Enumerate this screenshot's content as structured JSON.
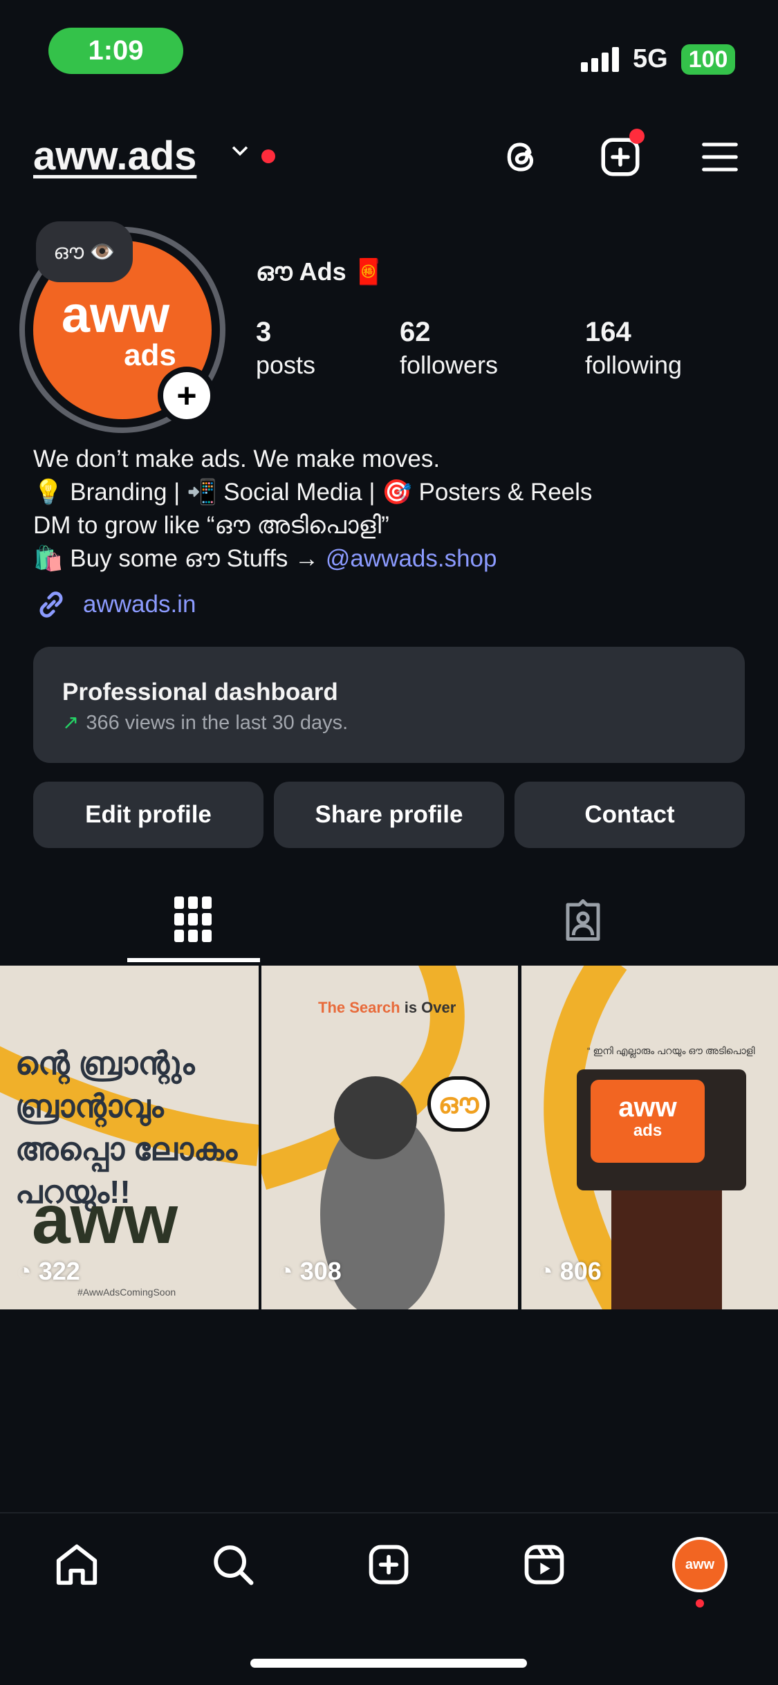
{
  "status_bar": {
    "time": "1:09",
    "network": "5G",
    "battery": "100"
  },
  "header": {
    "username": "aww.ads"
  },
  "profile": {
    "note": "ഔ 👁️",
    "avatar_text": "aww",
    "avatar_sub": "ads",
    "display_name": "ഔ Ads 🧧",
    "stats": [
      {
        "value": "3",
        "label": "posts"
      },
      {
        "value": "62",
        "label": "followers"
      },
      {
        "value": "164",
        "label": "following"
      }
    ],
    "bio": [
      "We don’t make ads. We make moves.",
      "💡 Branding | 📲 Social Media | 🎯 Posters & Reels",
      "DM to grow like “ഔ അടിപൊളി”"
    ],
    "bio_last_prefix": "🛍️ Buy some ഔ Stuffs → ",
    "bio_mention": "@awwads.shop",
    "link": "awwads.in"
  },
  "dashboard": {
    "title": "Professional dashboard",
    "subtitle": "366 views in the last 30 days."
  },
  "buttons": {
    "edit": "Edit profile",
    "share": "Share profile",
    "contact": "Contact"
  },
  "posts": [
    {
      "views": "322",
      "headline": "ന്റെ ബ്രാന്റും ബ്രാന്റാവും അപ്പൊ ലോകം പറയും!!",
      "logo": "aww",
      "tag": "#AwwAdsComingSoon"
    },
    {
      "views": "308",
      "title_a": "The Search",
      "title_b": " is Over",
      "bubble": "ഔ"
    },
    {
      "views": "806",
      "quote": "“ ഇനി എല്ലാരും പറയും ഔ അടിപൊളി",
      "logo": "aww",
      "logo_sub": "ads"
    }
  ],
  "colors": {
    "accent": "#f26522",
    "link": "#8c9bff",
    "notification": "#ff2c3c",
    "trend": "#25d366",
    "post_yellow": "#f0b02a"
  }
}
